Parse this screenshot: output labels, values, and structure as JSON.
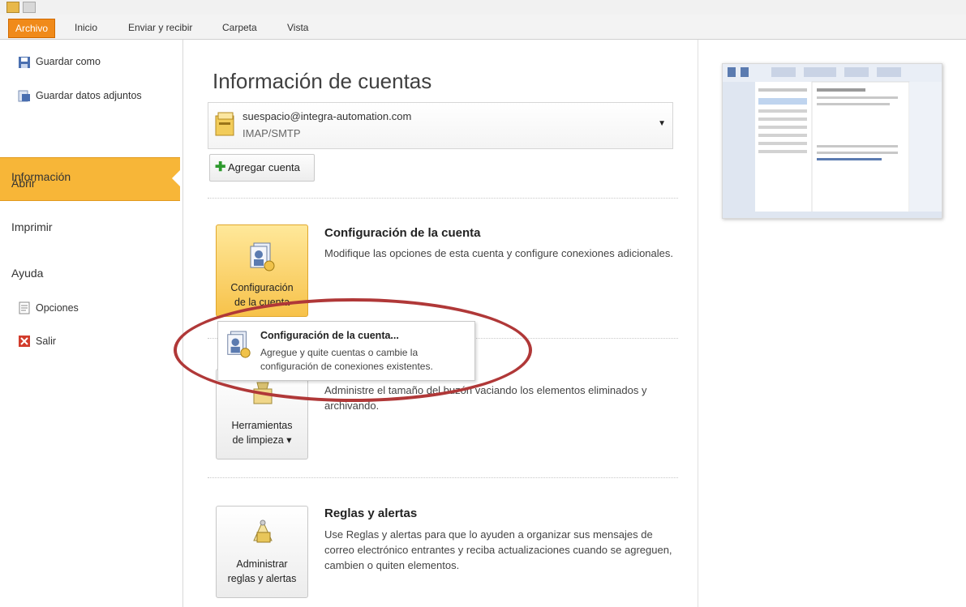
{
  "ribbon": {
    "tabs": [
      "Archivo",
      "Inicio",
      "Enviar y recibir",
      "Carpeta",
      "Vista"
    ]
  },
  "sidebar": {
    "save_as": "Guardar como",
    "save_attachments": "Guardar datos adjuntos",
    "info": "Información",
    "open": "Abrir",
    "print": "Imprimir",
    "help": "Ayuda",
    "options": "Opciones",
    "exit": "Salir"
  },
  "main": {
    "title": "Información de cuentas",
    "account_email": "suespacio@integra-automation.com",
    "account_type": "IMAP/SMTP",
    "add_account": "Agregar cuenta",
    "account_settings_btn_line1": "Configuración",
    "account_settings_btn_line2": "de la cuenta",
    "account_settings_title": "Configuración de la cuenta",
    "account_settings_desc": "Modifique las opciones de esta cuenta y configure conexiones adicionales.",
    "cleanup_btn_line1": "Herramientas",
    "cleanup_btn_line2": "de limpieza ▾",
    "cleanup_desc": "Administre el tamaño del buzón vaciando los elementos eliminados y archivando.",
    "rules_btn_line1": "Administrar",
    "rules_btn_line2": "reglas y alertas",
    "rules_title": "Reglas y alertas",
    "rules_desc": "Use Reglas y alertas para que lo ayuden a organizar sus mensajes de correo electrónico entrantes y reciba actualizaciones cuando se agreguen, cambien o quiten elementos."
  },
  "popup": {
    "title": "Configuración de la cuenta...",
    "desc": "Agregue y quite cuentas o cambie la configuración de conexiones existentes."
  },
  "colors": {
    "accent": "#f7b638",
    "file_tab": "#f08a1a",
    "highlight_circle": "#b03838"
  }
}
